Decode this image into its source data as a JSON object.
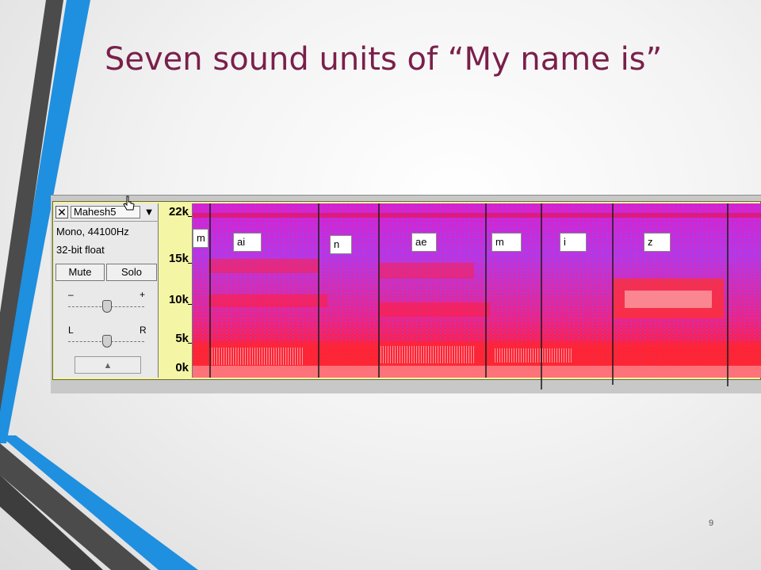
{
  "slide": {
    "title": "Seven sound units of “My name is”",
    "page_number": "9",
    "accent_colors": {
      "title": "#7a1f4a",
      "stripe_blue": "#1e88d8",
      "stripe_dark": "#4a4a4a"
    }
  },
  "track": {
    "close_icon": "✕",
    "name": "Mahesh5",
    "menu_icon": "▼",
    "info_line1": "Mono, 44100Hz",
    "info_line2": "32-bit float",
    "mute_label": "Mute",
    "solo_label": "Solo",
    "gain": {
      "minus": "–",
      "plus": "+"
    },
    "pan": {
      "left": "L",
      "right": "R"
    },
    "collapse_icon": "▲"
  },
  "ruler": {
    "ticks": [
      "22k",
      "15k",
      "10k",
      "5k",
      "0k"
    ]
  },
  "segments": [
    "m",
    "ai",
    "n",
    "ae",
    "m",
    "i",
    "z"
  ]
}
